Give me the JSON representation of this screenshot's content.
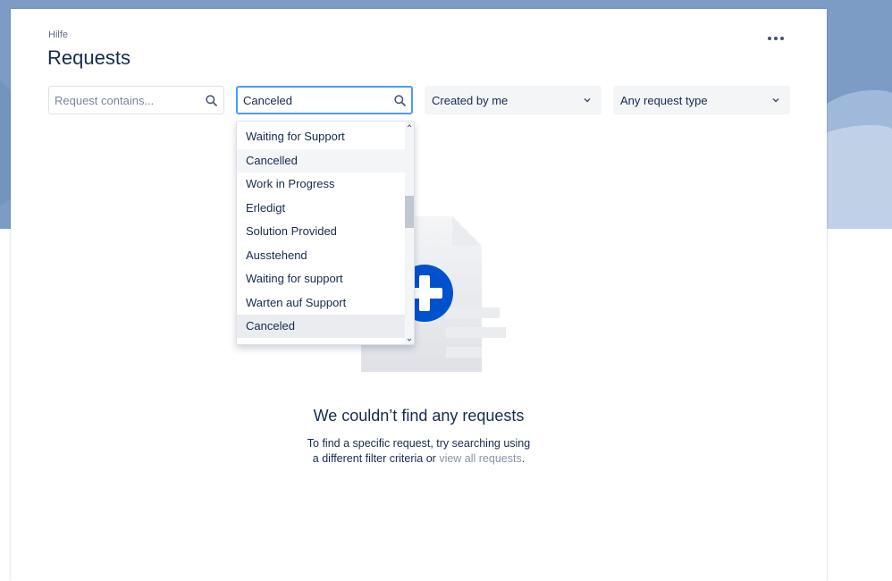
{
  "breadcrumb": {
    "label": "Hilfe"
  },
  "page": {
    "title": "Requests"
  },
  "filters": {
    "search": {
      "placeholder": "Request contains...",
      "value": ""
    },
    "status": {
      "value": "Canceled"
    },
    "created_by": {
      "value": "Created by me"
    },
    "request_type": {
      "value": "Any request type"
    }
  },
  "status_options": [
    {
      "label": "Waiting for Support"
    },
    {
      "label": "Cancelled"
    },
    {
      "label": "Work in Progress"
    },
    {
      "label": "Erledigt"
    },
    {
      "label": "Solution Provided"
    },
    {
      "label": "Ausstehend"
    },
    {
      "label": "Waiting for support"
    },
    {
      "label": "Warten auf Support"
    },
    {
      "label": "Canceled"
    }
  ],
  "empty_state": {
    "title": "We couldn’t find any requests",
    "text_before": "To find a specific request, try searching using a different filter criteria or",
    "link": "view all requests",
    "text_after": "."
  },
  "colors": {
    "banner": "#7c9cc5",
    "accent": "#0052cc",
    "focus": "#4c9aff"
  },
  "icons": {
    "search": "search-icon",
    "more": "more-icon",
    "chevron": "chevron-down-icon",
    "illustration": "document-plus-icon"
  }
}
